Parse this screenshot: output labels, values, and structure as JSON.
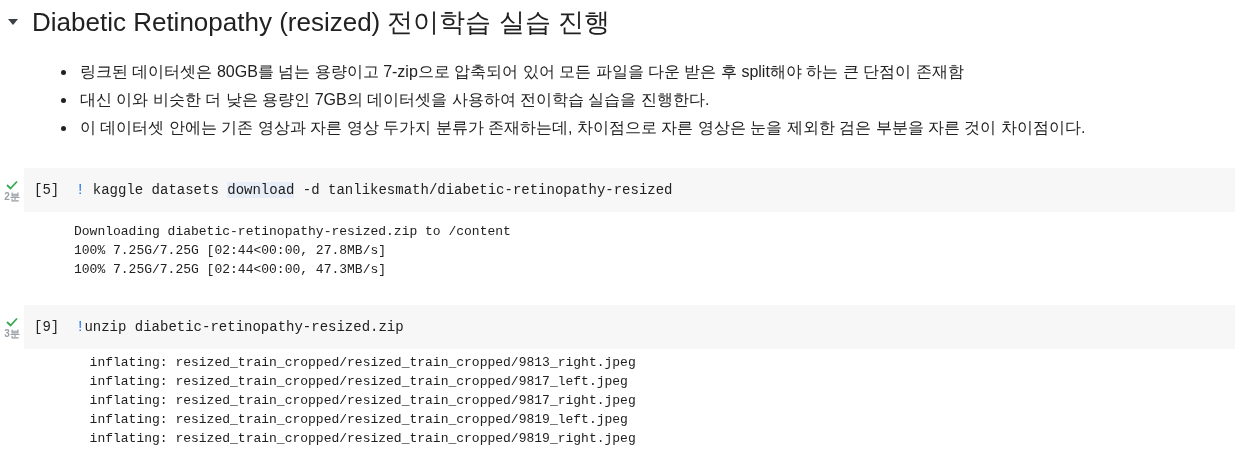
{
  "section": {
    "expanded": true,
    "title": "Diabetic Retinopathy (resized) 전이학습 실습 진행"
  },
  "bullets": [
    "링크된 데이터셋은 80GB를 넘는 용량이고 7-zip으로 압축되어 있어 모든 파일을 다운 받은 후 split해야 하는 큰 단점이 존재함",
    "대신 이와 비슷한 더 낮은 용량인 7GB의 데이터셋을 사용하여 전이학습 실습을 진행한다.",
    "이 데이터셋 안에는 기존 영상과 자른 영상 두가지 분류가 존재하는데, 차이점으로 자른 영상은 눈을 제외한 검은 부분을 자른 것이 차이점이다."
  ],
  "cells": [
    {
      "completed": true,
      "duration": "2분",
      "exec_count": "[5]",
      "code": [
        {
          "kind": "bang",
          "text": "!"
        },
        {
          "kind": "plain",
          "text": " kaggle datasets "
        },
        {
          "kind": "highlight",
          "text": "download"
        },
        {
          "kind": "plain",
          "text": " -d tanlikesmath/diabetic-retinopathy-resized"
        }
      ],
      "output": [
        "Downloading diabetic-retinopathy-resized.zip to /content",
        "100% 7.25G/7.25G [02:44<00:00, 27.8MB/s]",
        "100% 7.25G/7.25G [02:44<00:00, 47.3MB/s]"
      ]
    },
    {
      "completed": true,
      "duration": "3분",
      "exec_count": "[9]",
      "code": [
        {
          "kind": "bang",
          "text": "!"
        },
        {
          "kind": "plain",
          "text": "unzip diabetic-retinopathy-resized.zip"
        }
      ],
      "output": [
        "  inflating: resized_train_cropped/resized_train_cropped/9813_right.jpeg",
        "  inflating: resized_train_cropped/resized_train_cropped/9817_left.jpeg",
        "  inflating: resized_train_cropped/resized_train_cropped/9817_right.jpeg",
        "  inflating: resized_train_cropped/resized_train_cropped/9819_left.jpeg",
        "  inflating: resized_train_cropped/resized_train_cropped/9819_right.jpeg"
      ]
    }
  ]
}
